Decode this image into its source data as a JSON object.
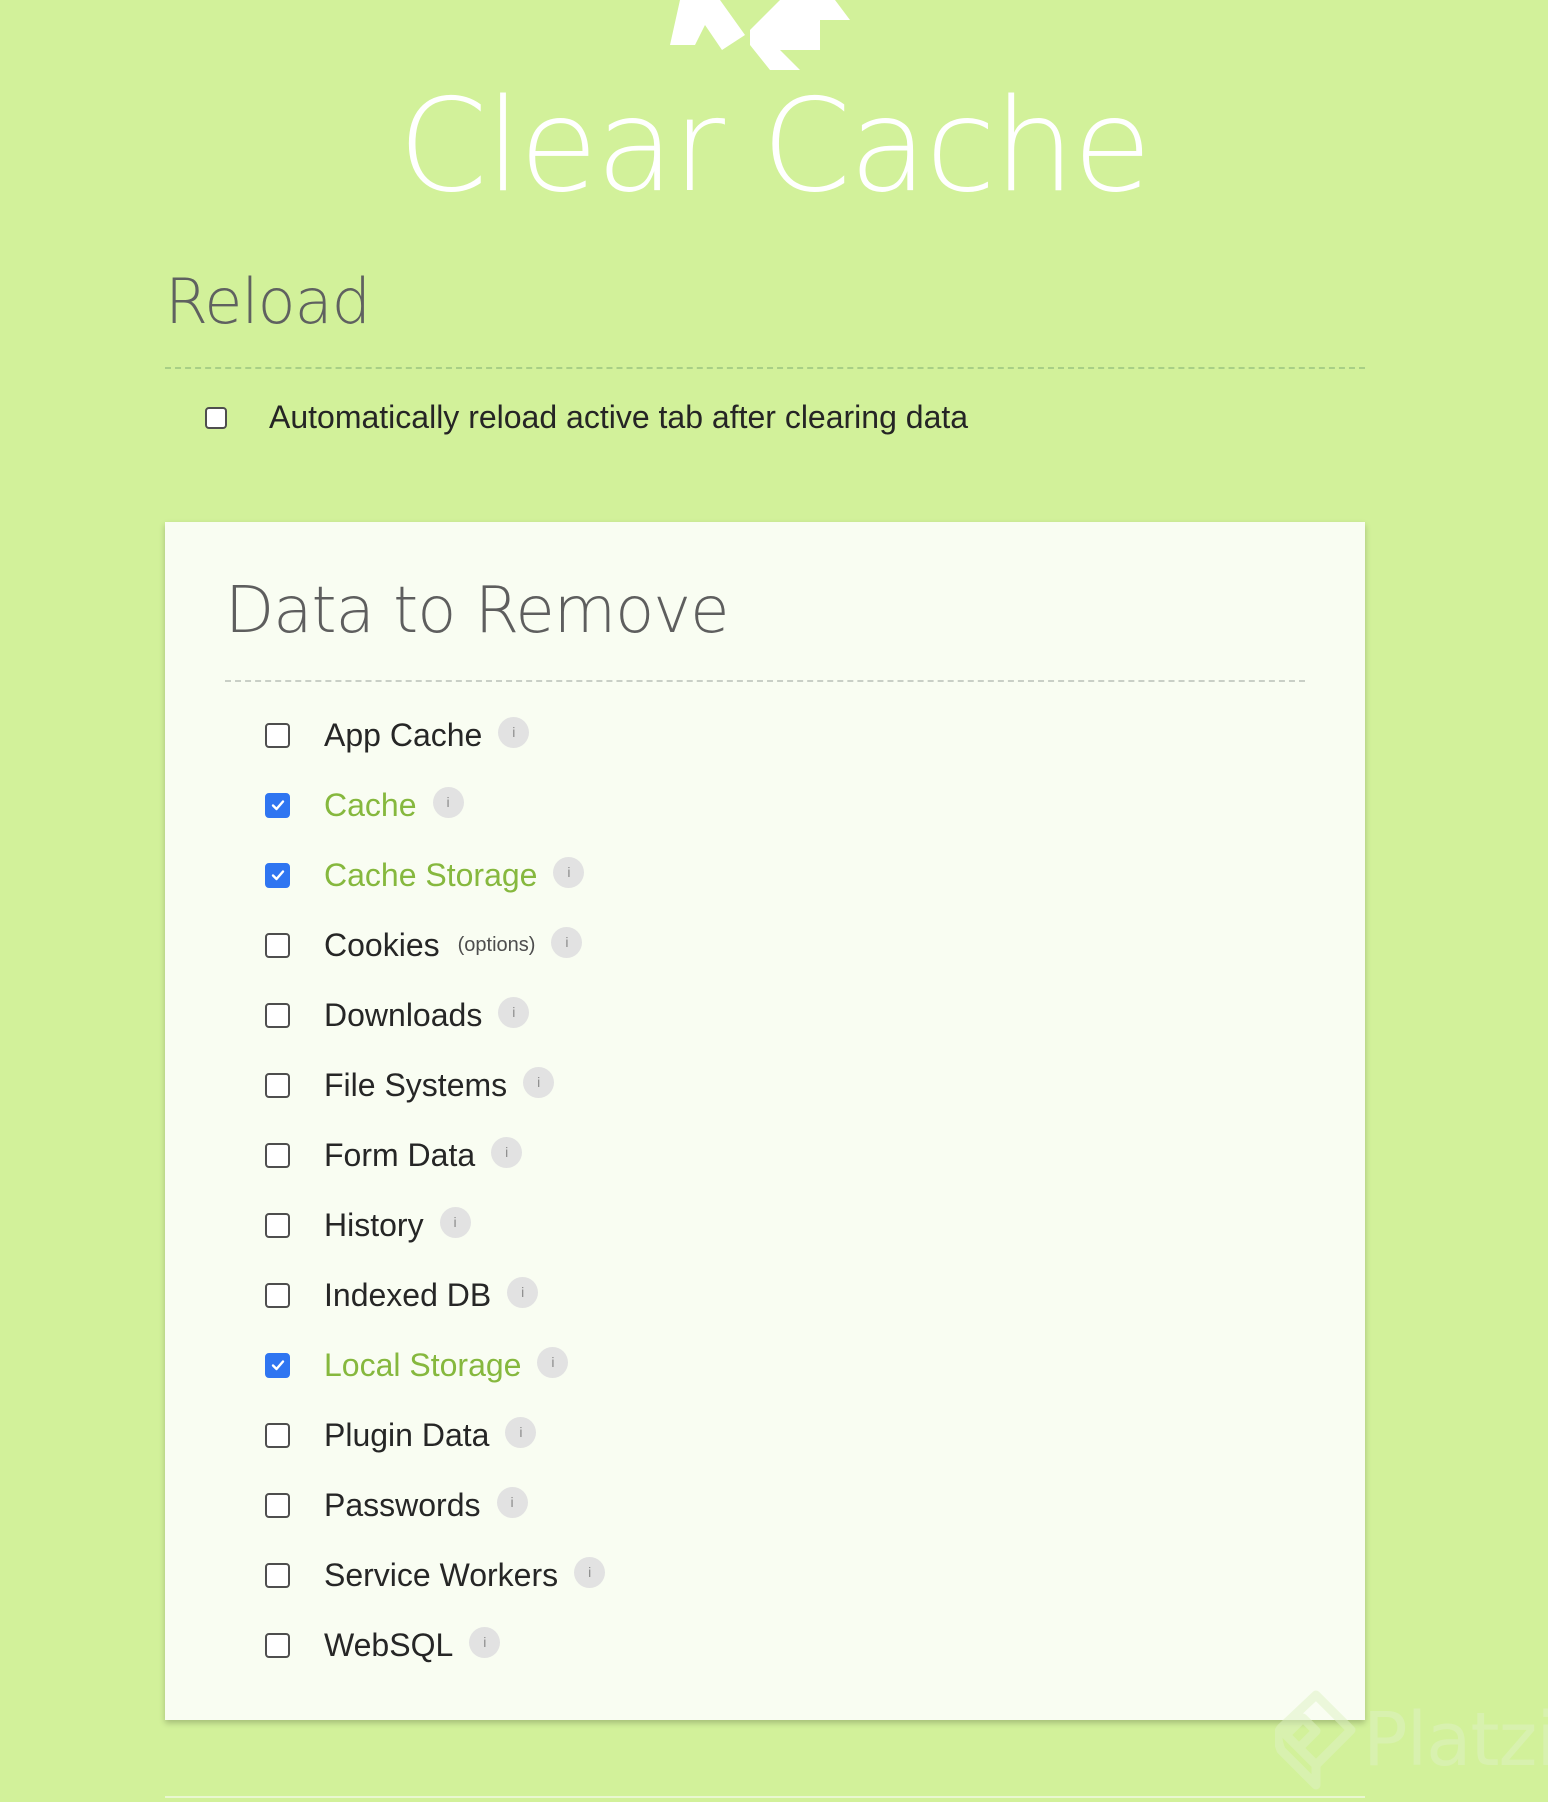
{
  "header": {
    "logo_icon": "recycle-icon",
    "title": "Clear Cache"
  },
  "reload": {
    "title": "Reload",
    "auto_reload": {
      "label": "Automatically reload active tab after clearing data",
      "checked": false
    }
  },
  "data_to_remove": {
    "title": "Data to Remove",
    "items": [
      {
        "label": "App Cache",
        "checked": false,
        "info": "i"
      },
      {
        "label": "Cache",
        "checked": true,
        "info": "i"
      },
      {
        "label": "Cache Storage",
        "checked": true,
        "info": "i"
      },
      {
        "label": "Cookies",
        "checked": false,
        "options": "(options)",
        "info": "i"
      },
      {
        "label": "Downloads",
        "checked": false,
        "info": "i"
      },
      {
        "label": "File Systems",
        "checked": false,
        "info": "i"
      },
      {
        "label": "Form Data",
        "checked": false,
        "info": "i"
      },
      {
        "label": "History",
        "checked": false,
        "info": "i"
      },
      {
        "label": "Indexed DB",
        "checked": false,
        "info": "i"
      },
      {
        "label": "Local Storage",
        "checked": true,
        "info": "i"
      },
      {
        "label": "Plugin Data",
        "checked": false,
        "info": "i"
      },
      {
        "label": "Passwords",
        "checked": false,
        "info": "i"
      },
      {
        "label": "Service Workers",
        "checked": false,
        "info": "i"
      },
      {
        "label": "WebSQL",
        "checked": false,
        "info": "i"
      }
    ]
  },
  "watermark": {
    "text": "Platzi",
    "icon": "platzi-logo-icon"
  },
  "colors": {
    "background": "#d2f19a",
    "card": "#f9fdf2",
    "checked_label": "#86b83e",
    "checkbox_checked": "#2f75f1"
  }
}
